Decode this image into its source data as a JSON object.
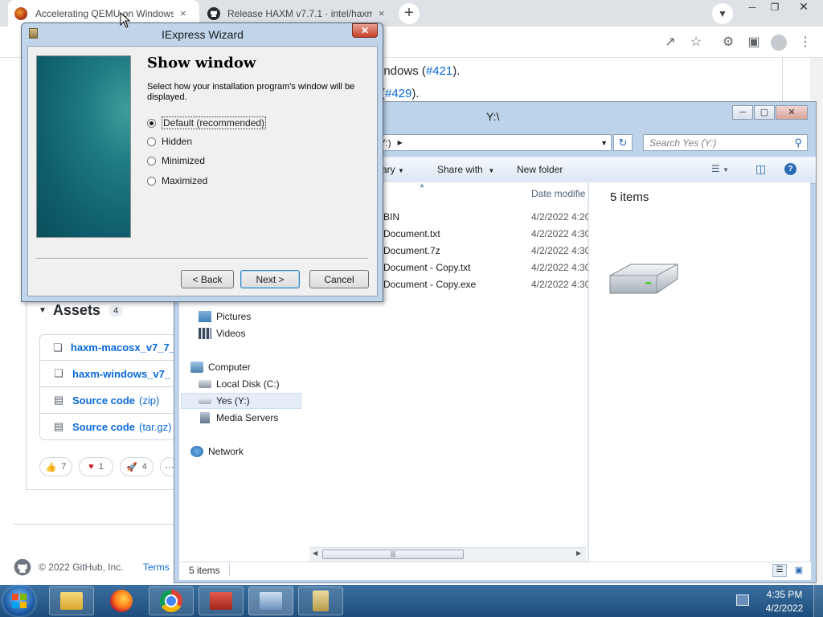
{
  "chrome": {
    "tabs": [
      {
        "title": "Accelerating QEMU on Windows"
      },
      {
        "title": "Release HAXM v7.7.1 · intel/haxm"
      }
    ],
    "new_tab": "+",
    "close": "×"
  },
  "github": {
    "line1_text": "indows (",
    "line1_link": "#421",
    "line1_end": ").",
    "line2_link": "#429",
    "line2_end": ").",
    "assets_title": "Assets",
    "assets_count": "4",
    "assets": [
      {
        "label": "haxm-macosx_v7_7_",
        "suffix": "",
        "icon": "package-icon"
      },
      {
        "label": "haxm-windows_v7_",
        "suffix": "",
        "icon": "package-icon"
      },
      {
        "label": "Source code",
        "suffix": "(zip)",
        "icon": "file-zip-icon"
      },
      {
        "label": "Source code",
        "suffix": "(tar.gz)",
        "icon": "file-zip-icon"
      }
    ],
    "reactions": [
      {
        "emoji": "👍",
        "count": "7"
      },
      {
        "emoji": "♥",
        "count": "1"
      },
      {
        "emoji": "🚀",
        "count": "4"
      }
    ],
    "footer_copyright": "© 2022 GitHub, Inc.",
    "footer_terms": "Terms"
  },
  "explorer": {
    "title": "Y:\\",
    "address": "Y:)",
    "search_placeholder": "Search Yes (Y:)",
    "toolbar": {
      "library": "rary",
      "share": "Share with",
      "new_folder": "New folder"
    },
    "column_date": "Date modifie",
    "files": [
      {
        "name": "BIN",
        "date": "4/2/2022 4:20"
      },
      {
        "name": "Document.txt",
        "date": "4/2/2022 4:30"
      },
      {
        "name": "Document.7z",
        "date": "4/2/2022 4:30"
      },
      {
        "name": "Document - Copy.txt",
        "date": "4/2/2022 4:30"
      },
      {
        "name": "Document - Copy.exe",
        "date": "4/2/2022 4:30"
      }
    ],
    "nav": {
      "pictures": "Pictures",
      "videos": "Videos",
      "computer": "Computer",
      "local_disk": "Local Disk (C:)",
      "yes_drive": "Yes (Y:)",
      "media_servers": "Media Servers",
      "network": "Network"
    },
    "preview_count": "5 items",
    "status_count": "5 items"
  },
  "iexpress": {
    "title": "IExpress Wizard",
    "heading": "Show window",
    "description": "Select how your installation program's window will be displayed.",
    "options": [
      {
        "label": "Default (recommended)",
        "selected": true
      },
      {
        "label": "Hidden",
        "selected": false
      },
      {
        "label": "Minimized",
        "selected": false
      },
      {
        "label": "Maximized",
        "selected": false
      }
    ],
    "back_label": "< Back",
    "next_label": "Next >",
    "cancel_label": "Cancel"
  },
  "taskbar": {
    "time": "4:35 PM",
    "date": "4/2/2022"
  }
}
